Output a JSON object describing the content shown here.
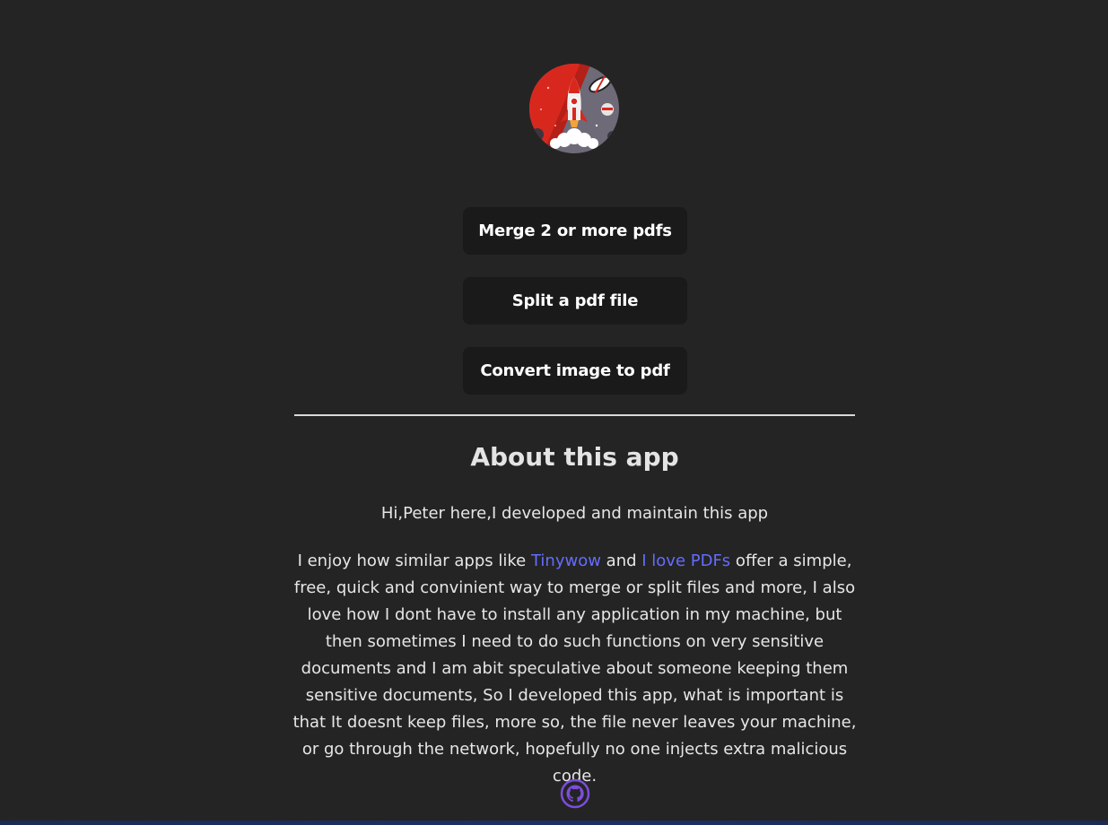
{
  "buttons": {
    "merge": "Merge 2 or more pdfs",
    "split": "Split a pdf file",
    "convert": "Convert image to pdf"
  },
  "about": {
    "title": "About this app",
    "intro": "Hi,Peter here,I developed and maintain this app",
    "p_before_link1": "I enjoy how similar apps like ",
    "link1": "Tinywow",
    "p_between_links": " and ",
    "link2": "I love PDFs",
    "p_after_links": " offer a simple, free, quick and convinient way to merge or split files and more, I also love how I dont have to install any application in my machine, but then sometimes I need to do such functions on very sensitive documents and I am abit speculative about someone keeping them sensitive documents, So I developed this app, what is important is that It doesnt keep files, more so, the file never leaves your machine, or go through the network, hopefully no one injects extra malicious code."
  },
  "icons": {
    "logo": "rocket-logo-icon",
    "github": "github-icon"
  },
  "colors": {
    "background": "#242424",
    "button_bg": "#1a1a1a",
    "link": "#646cff",
    "github_icon": "#7c4ddb",
    "logo_red": "#d8281e"
  }
}
